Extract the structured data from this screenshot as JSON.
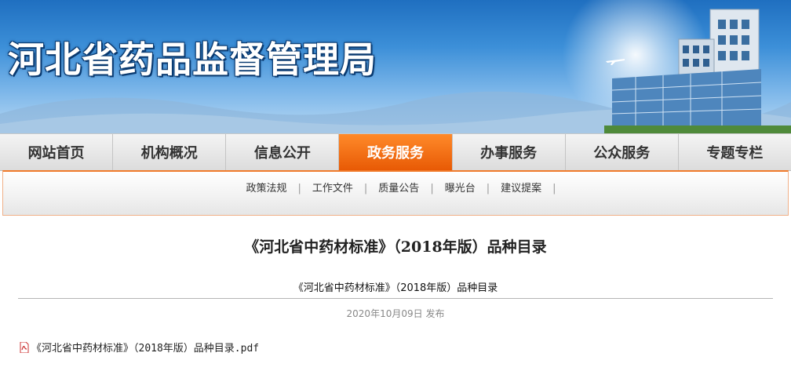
{
  "header": {
    "site_title": "河北省药品监督管理局"
  },
  "nav": {
    "items": [
      {
        "label": "网站首页"
      },
      {
        "label": "机构概况"
      },
      {
        "label": "信息公开"
      },
      {
        "label": "政务服务",
        "active": true
      },
      {
        "label": "办事服务"
      },
      {
        "label": "公众服务"
      },
      {
        "label": "专题专栏"
      }
    ]
  },
  "subnav": {
    "items": [
      {
        "label": "政策法规"
      },
      {
        "label": "工作文件"
      },
      {
        "label": "质量公告"
      },
      {
        "label": "曝光台"
      },
      {
        "label": "建议提案"
      }
    ]
  },
  "article": {
    "title": "《河北省中药材标准》（2018年版）品种目录",
    "subtitle": "《河北省中药材标准》（2018年版）品种目录",
    "date": "2020年10月09日",
    "date_suffix": "发布",
    "attachment": "《河北省中药材标准》（2018年版）品种目录.pdf"
  },
  "colors": {
    "accent": "#e85a05",
    "banner_blue": "#3c8fd8"
  }
}
